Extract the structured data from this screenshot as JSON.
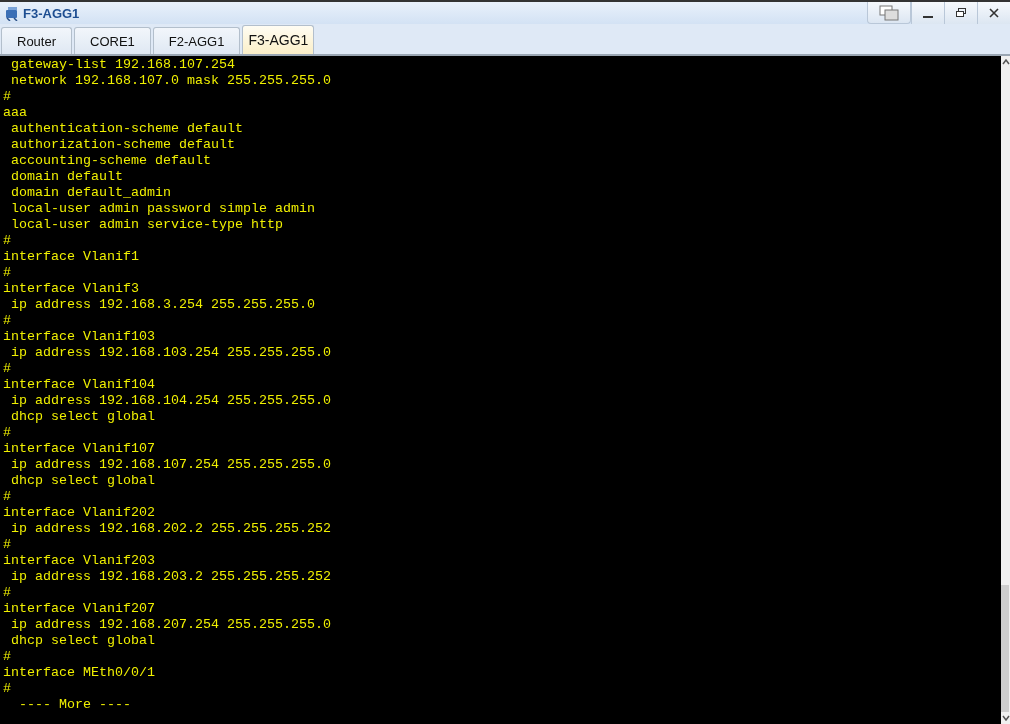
{
  "window": {
    "title": "F3-AGG1"
  },
  "tabs": [
    {
      "label": "Router",
      "selected": false
    },
    {
      "label": "CORE1",
      "selected": false
    },
    {
      "label": "F2-AGG1",
      "selected": false
    },
    {
      "label": "F3-AGG1",
      "selected": true
    }
  ],
  "terminal": {
    "lines": [
      " gateway-list 192.168.107.254",
      " network 192.168.107.0 mask 255.255.255.0",
      "#",
      "aaa",
      " authentication-scheme default",
      " authorization-scheme default",
      " accounting-scheme default",
      " domain default",
      " domain default_admin",
      " local-user admin password simple admin",
      " local-user admin service-type http",
      "#",
      "interface Vlanif1",
      "#",
      "interface Vlanif3",
      " ip address 192.168.3.254 255.255.255.0",
      "#",
      "interface Vlanif103",
      " ip address 192.168.103.254 255.255.255.0",
      "#",
      "interface Vlanif104",
      " ip address 192.168.104.254 255.255.255.0",
      " dhcp select global",
      "#",
      "interface Vlanif107",
      " ip address 192.168.107.254 255.255.255.0",
      " dhcp select global",
      "#",
      "interface Vlanif202",
      " ip address 192.168.202.2 255.255.255.252",
      "#",
      "interface Vlanif203",
      " ip address 192.168.203.2 255.255.255.252",
      "#",
      "interface Vlanif207",
      " ip address 192.168.207.254 255.255.255.0",
      " dhcp select global",
      "#",
      "interface MEth0/0/1",
      "#",
      "  ---- More ----"
    ]
  }
}
